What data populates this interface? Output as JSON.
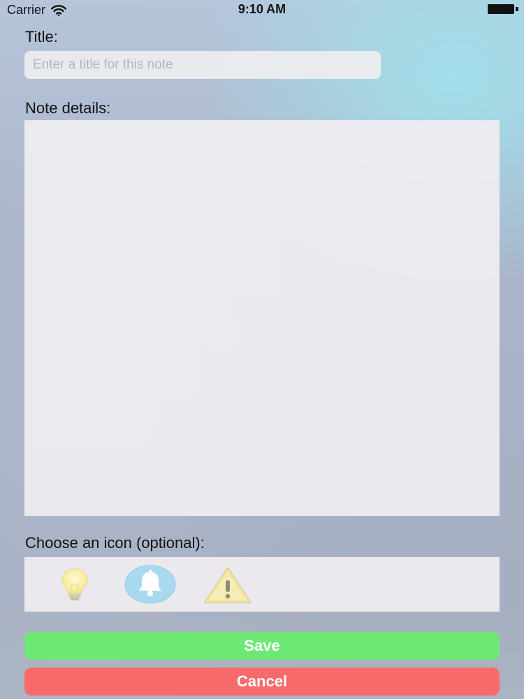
{
  "status_bar": {
    "carrier": "Carrier",
    "time": "9:10 AM",
    "wifi_icon": "wifi-icon",
    "battery_icon": "battery-icon"
  },
  "form": {
    "title_label": "Title:",
    "title_placeholder": "Enter a title for this note",
    "title_value": "",
    "details_label": "Note details:",
    "details_value": "",
    "icon_label": "Choose an icon (optional):",
    "icons": [
      "lightbulb-icon",
      "bell-icon",
      "warning-icon"
    ]
  },
  "buttons": {
    "save_label": "Save",
    "cancel_label": "Cancel"
  },
  "colors": {
    "save": "#6de874",
    "cancel": "#f76b6b",
    "field_background": "#eeecf0"
  }
}
